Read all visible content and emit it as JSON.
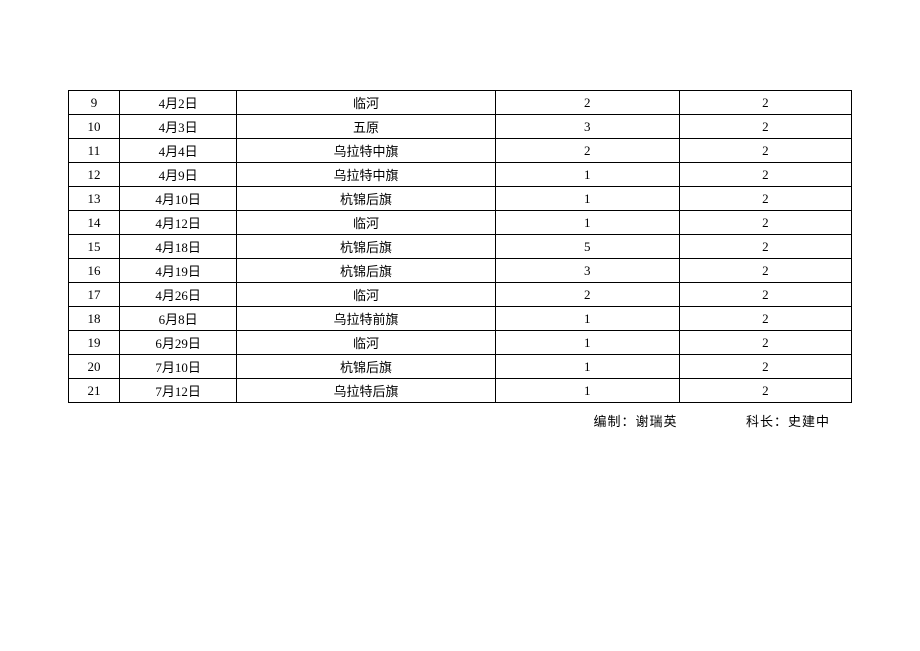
{
  "chart_data": {
    "type": "table",
    "rows": [
      {
        "idx": "9",
        "date": "4月2日",
        "location": "临河",
        "v1": "2",
        "v2": "2"
      },
      {
        "idx": "10",
        "date": "4月3日",
        "location": "五原",
        "v1": "3",
        "v2": "2"
      },
      {
        "idx": "11",
        "date": "4月4日",
        "location": "乌拉特中旗",
        "v1": "2",
        "v2": "2"
      },
      {
        "idx": "12",
        "date": "4月9日",
        "location": "乌拉特中旗",
        "v1": "1",
        "v2": "2"
      },
      {
        "idx": "13",
        "date": "4月10日",
        "location": "杭锦后旗",
        "v1": "1",
        "v2": "2"
      },
      {
        "idx": "14",
        "date": "4月12日",
        "location": "临河",
        "v1": "1",
        "v2": "2"
      },
      {
        "idx": "15",
        "date": "4月18日",
        "location": "杭锦后旗",
        "v1": "5",
        "v2": "2"
      },
      {
        "idx": "16",
        "date": "4月19日",
        "location": "杭锦后旗",
        "v1": "3",
        "v2": "2"
      },
      {
        "idx": "17",
        "date": "4月26日",
        "location": "临河",
        "v1": "2",
        "v2": "2"
      },
      {
        "idx": "18",
        "date": "6月8日",
        "location": "乌拉特前旗",
        "v1": "1",
        "v2": "2"
      },
      {
        "idx": "19",
        "date": "6月29日",
        "location": "临河",
        "v1": "1",
        "v2": "2"
      },
      {
        "idx": "20",
        "date": "7月10日",
        "location": "杭锦后旗",
        "v1": "1",
        "v2": "2"
      },
      {
        "idx": "21",
        "date": "7月12日",
        "location": "乌拉特后旗",
        "v1": "1",
        "v2": "2"
      }
    ]
  },
  "footer": {
    "compiler_label": "编制：",
    "compiler_name": "谢瑞英",
    "chief_label": "科长：",
    "chief_name": "史建中"
  }
}
